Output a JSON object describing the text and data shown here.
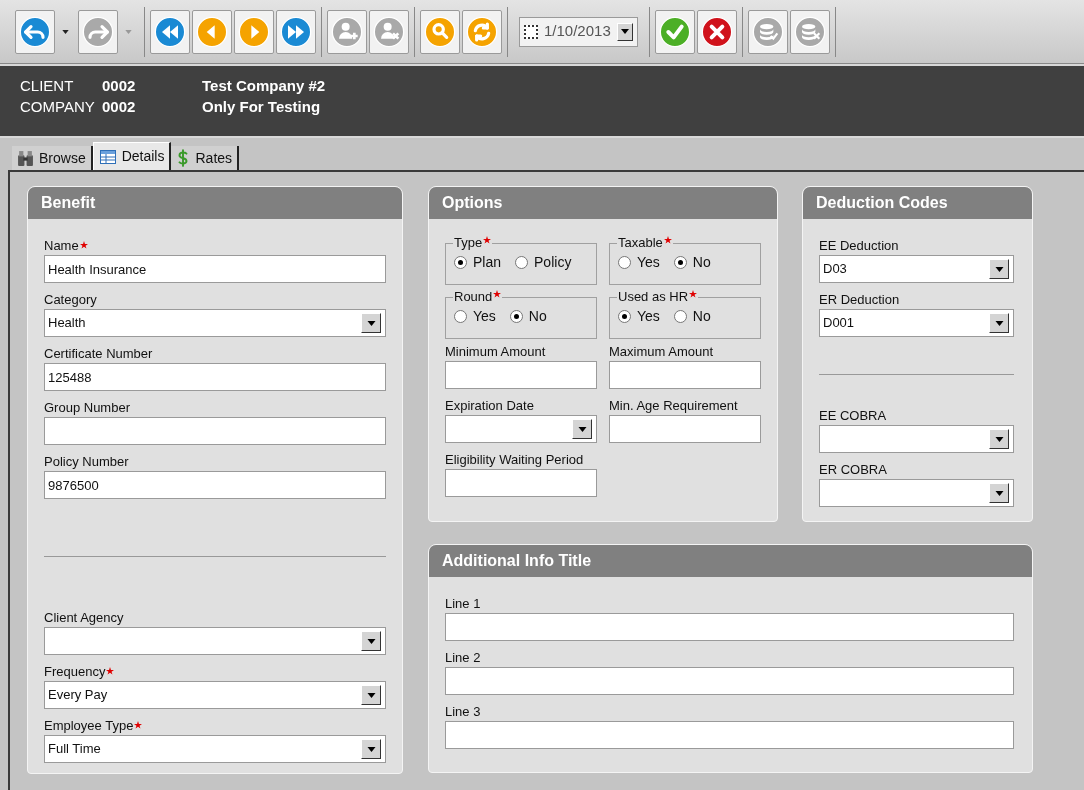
{
  "toolbar": {
    "groups": [
      {
        "items": [
          {
            "kind": "undo",
            "color": "#1a8ad4",
            "disabled": false,
            "caret": true
          },
          {
            "kind": "redo",
            "disabled": true,
            "caret": true
          }
        ]
      },
      {
        "items": [
          {
            "kind": "first",
            "color": "#1a8ad4",
            "disabled": false,
            "caret": false
          },
          {
            "kind": "prev",
            "color": "#f5a300",
            "disabled": false,
            "caret": false
          },
          {
            "kind": "next",
            "color": "#f5a300",
            "disabled": false,
            "caret": false
          },
          {
            "kind": "last",
            "color": "#1a8ad4",
            "disabled": false,
            "caret": false
          }
        ]
      },
      {
        "items": [
          {
            "kind": "add-person",
            "disabled": true,
            "caret": false
          },
          {
            "kind": "remove-person",
            "disabled": true,
            "caret": false
          }
        ]
      },
      {
        "items": [
          {
            "kind": "search",
            "color": "#f5a300",
            "disabled": false,
            "caret": false
          },
          {
            "kind": "refresh",
            "color": "#f5a300",
            "disabled": false,
            "caret": false
          }
        ]
      },
      {
        "items": [
          {
            "kind": "date",
            "checked": false,
            "value": "1/10/2013"
          }
        ]
      },
      {
        "items": [
          {
            "kind": "check",
            "color": "#4caf26",
            "disabled": false,
            "caret": false
          },
          {
            "kind": "cross",
            "color": "#d0121b",
            "disabled": false,
            "caret": false
          }
        ]
      },
      {
        "items": [
          {
            "kind": "db-check",
            "disabled": true,
            "caret": false
          },
          {
            "kind": "db-cross",
            "disabled": true,
            "caret": false
          }
        ]
      }
    ]
  },
  "header": {
    "rows": [
      {
        "label": "CLIENT",
        "code": "0002",
        "name": "Test Company #2"
      },
      {
        "label": "COMPANY",
        "code": "0002",
        "name": "Only For Testing"
      }
    ]
  },
  "tabs": [
    {
      "kind": "binoculars",
      "label": "Browse",
      "selected": false
    },
    {
      "kind": "table",
      "label": "Details",
      "selected": true
    },
    {
      "kind": "dollar",
      "label": "Rates",
      "selected": false
    }
  ],
  "benefit": {
    "title": "Benefit",
    "fields": [
      {
        "kind": "text",
        "label": "Name",
        "required": true,
        "value": "Health Insurance"
      },
      {
        "kind": "select",
        "label": "Category",
        "required": false,
        "value": "Health"
      },
      {
        "kind": "text",
        "label": "Certificate Number",
        "required": false,
        "value": "125488"
      },
      {
        "kind": "text",
        "label": "Group Number",
        "required": false
      },
      {
        "kind": "text",
        "label": "Policy Number",
        "required": false,
        "value": "9876500"
      },
      {
        "kind": "divider"
      },
      {
        "kind": "select",
        "label": "Client Agency",
        "required": false
      },
      {
        "kind": "select",
        "label": "Frequency",
        "required": true,
        "value": "Every Pay"
      },
      {
        "kind": "select",
        "label": "Employee Type",
        "required": true,
        "value": "Full Time"
      }
    ]
  },
  "options": {
    "title": "Options",
    "groups": [
      {
        "label": "Type",
        "required": true,
        "options": [
          {
            "label": "Plan",
            "selected": true
          },
          {
            "label": "Policy",
            "selected": false
          }
        ]
      },
      {
        "label": "Taxable",
        "required": true,
        "options": [
          {
            "label": "Yes",
            "selected": false
          },
          {
            "label": "No",
            "selected": true
          }
        ]
      },
      {
        "label": "Round",
        "required": true,
        "options": [
          {
            "label": "Yes",
            "selected": false
          },
          {
            "label": "No",
            "selected": true
          }
        ]
      },
      {
        "label": "Used as HR",
        "required": true,
        "options": [
          {
            "label": "Yes",
            "selected": true
          },
          {
            "label": "No",
            "selected": false
          }
        ]
      }
    ],
    "fields": [
      {
        "kind": "text",
        "label": "Minimum Amount",
        "required": false
      },
      {
        "kind": "text",
        "label": "Maximum Amount",
        "required": false
      },
      {
        "kind": "select",
        "label": "Expiration Date",
        "required": false
      },
      {
        "kind": "text",
        "label": "Min. Age Requirement",
        "required": false
      },
      {
        "kind": "text",
        "label": "Eligibility Waiting Period",
        "required": false
      }
    ]
  },
  "deduction_codes": {
    "title": "Deduction Codes",
    "fields": [
      {
        "kind": "select",
        "label": "EE Deduction",
        "required": false,
        "value": "D03"
      },
      {
        "kind": "select",
        "label": "ER Deduction",
        "required": false,
        "value": "D001"
      },
      {
        "kind": "divider"
      },
      {
        "kind": "select",
        "label": "EE COBRA",
        "required": false
      },
      {
        "kind": "select",
        "label": "ER COBRA",
        "required": false
      }
    ]
  },
  "additional_info": {
    "title": "Additional Info Title",
    "fields": [
      {
        "kind": "text",
        "label": "Line 1",
        "required": false
      },
      {
        "kind": "text",
        "label": "Line 2",
        "required": false
      },
      {
        "kind": "text",
        "label": "Line 3",
        "required": false
      }
    ]
  }
}
